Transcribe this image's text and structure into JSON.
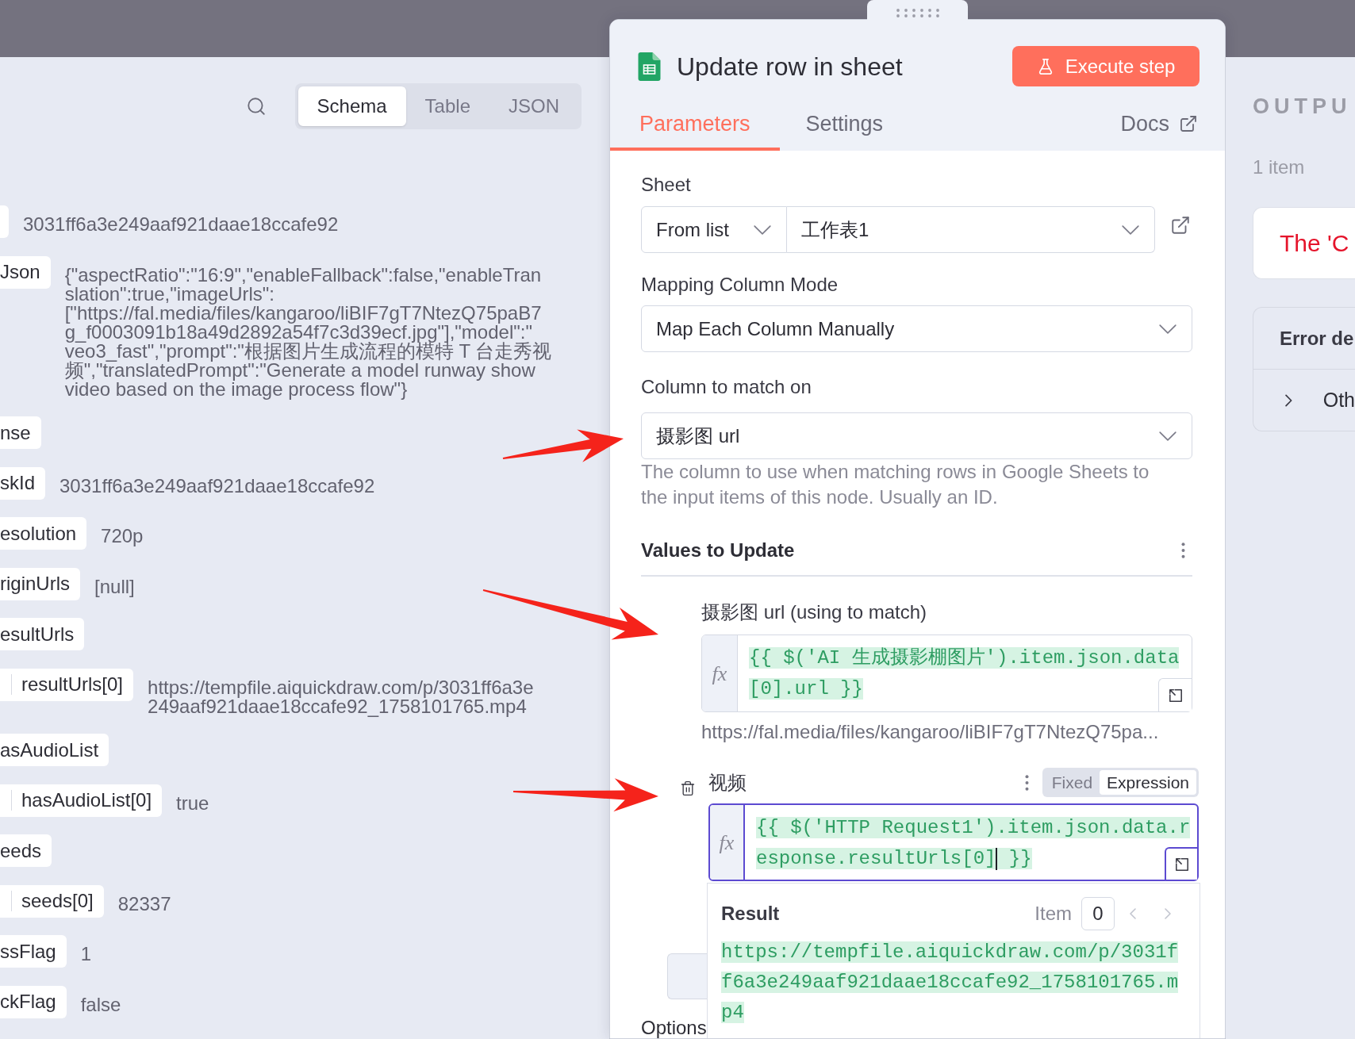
{
  "input_panel": {
    "view_tabs": [
      {
        "label": "Schema",
        "selected": true
      },
      {
        "label": "Table",
        "selected": false
      },
      {
        "label": "JSON",
        "selected": false
      }
    ],
    "schema_rows": [
      {
        "value": "3031ff6a3e249aaf921daae18ccafe92"
      },
      {
        "key": "Json",
        "value_lines": [
          "{\"aspectRatio\":\"16:9\",\"enableFallback\":false,\"enableTran",
          "slation\":true,\"imageUrls\":",
          "[\"https://fal.media/files/kangaroo/liBIF7gT7NtezQ75paB7",
          "g_f0003091b18a49d2892a54f7c3d39ecf.jpg\"],\"model\":\"",
          "veo3_fast\",\"prompt\":\"根据图片生成流程的模特 T 台走秀视",
          "频\",\"translatedPrompt\":\"Generate a model runway show",
          "video based on the image process flow\"}"
        ]
      },
      {
        "key": "nse"
      },
      {
        "key": "skId",
        "value": "3031ff6a3e249aaf921daae18ccafe92"
      },
      {
        "key": "esolution",
        "value": "720p"
      },
      {
        "key": "riginUrls",
        "value": "[null]"
      },
      {
        "key": "esultUrls",
        "children": [
          {
            "key": "resultUrls[0]",
            "value_lines": [
              "https://tempfile.aiquickdraw.com/p/3031ff6a3e",
              "249aaf921daae18ccafe92_1758101765.mp4"
            ]
          }
        ]
      },
      {
        "key": "asAudioList",
        "children": [
          {
            "key": "hasAudioList[0]",
            "value": "true"
          }
        ]
      },
      {
        "key": "eeds",
        "children": [
          {
            "key": "seeds[0]",
            "value": "82337"
          }
        ]
      },
      {
        "key": "ssFlag",
        "value": "1"
      },
      {
        "key": "ckFlag",
        "value": "false"
      }
    ]
  },
  "node_panel": {
    "title": "Update row in sheet",
    "execute_button": "Execute step",
    "tabs": [
      {
        "label": "Parameters",
        "selected": true
      },
      {
        "label": "Settings",
        "selected": false
      }
    ],
    "docs_link": "Docs",
    "parameters": [
      {
        "kind": "sheet",
        "label": "Sheet",
        "mode": "From list",
        "value": "工作表1"
      },
      {
        "kind": "select",
        "label": "Mapping Column Mode",
        "value": "Map Each Column Manually"
      },
      {
        "kind": "select",
        "label": "Column to match on",
        "value": "摄影图 url",
        "hint_lines": [
          "The column to use when matching rows in Google Sheets to",
          "the input items of this node. Usually an ID."
        ]
      }
    ],
    "values_section": {
      "title": "Values to Update",
      "fields": [
        {
          "label": "摄影图 url (using to match)",
          "hovered": false,
          "focused": false,
          "prefix": "fx",
          "expression": "{{ $('AI 生成摄影棚图片').item.json.data[0].url }}",
          "preview": "https://fal.media/files/kangaroo/liBIF7gT7NtezQ75pa..."
        },
        {
          "label": "视频",
          "hovered": true,
          "focused": true,
          "mode_toggle": [
            {
              "label": "Fixed",
              "selected": false
            },
            {
              "label": "Expression",
              "selected": true
            }
          ],
          "prefix": "fx",
          "expression": "{{ $('HTTP Request1').item.json.data.response.resultUrls[0]",
          "expression_after_cursor": " }}",
          "result": {
            "title": "Result",
            "item_label": "Item",
            "item_index": "0",
            "value": "https://tempfile.aiquickdraw.com/p/3031ff6a3e249aaf921daae18ccafe92_1758101765.mp4"
          }
        }
      ]
    },
    "options_label": "Options"
  },
  "output_panel": {
    "title": "OUTPU",
    "count": "1 item",
    "message": "The 'C",
    "error_card": {
      "title": "Error de",
      "rows": [
        {
          "label": "Oth",
          "expanded": false
        }
      ]
    }
  }
}
